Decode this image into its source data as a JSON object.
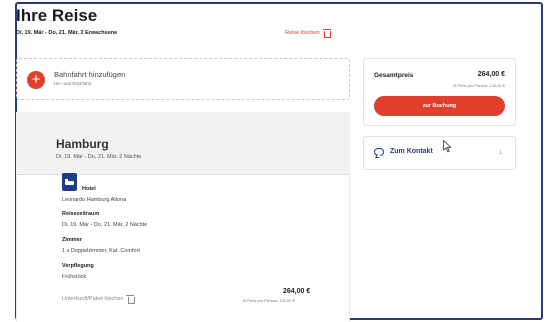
{
  "trip": {
    "title": "Ihre Reise",
    "subtitle": "Di, 19. Mär - Do, 21. Mär, 2 Erwachsene",
    "delete_label": "Reise löschen"
  },
  "add_train": {
    "label": "Bahnfahrt hinzufügen",
    "sublabel": "Hin- und Rückfahrt",
    "plus": "+"
  },
  "stay": {
    "city": "Hamburg",
    "dates": "Di, 19. Mär - Do, 21. Mär, 2 Nächte",
    "type_label": "Hotel",
    "hotel_name": "Leonardo Hamburg Altona",
    "period_label": "Reisezeitraum",
    "period_value": "Di, 19. Mär - Do, 21. Mär, 2 Nächte",
    "room_label": "Zimmer",
    "room_value": "1 x Doppelzimmer, Kat. Comfort",
    "board_label": "Verpflegung",
    "board_value": "Frühstück",
    "remove_label": "Unterkunft/Paket löschen",
    "price": "264,00 €",
    "price_per_person": "Ø Preis pro Person: 132,00 €"
  },
  "summary": {
    "total_label": "Gesamtpreis",
    "total_price": "264,00 €",
    "per_person": "Ø Preis pro Person: 132,00 €",
    "book_label": "zur Buchung"
  },
  "contact": {
    "label": "Zum Kontakt",
    "arrow": "↓"
  },
  "colors": {
    "accent": "#e0402b",
    "brand_blue": "#1e3c87"
  }
}
